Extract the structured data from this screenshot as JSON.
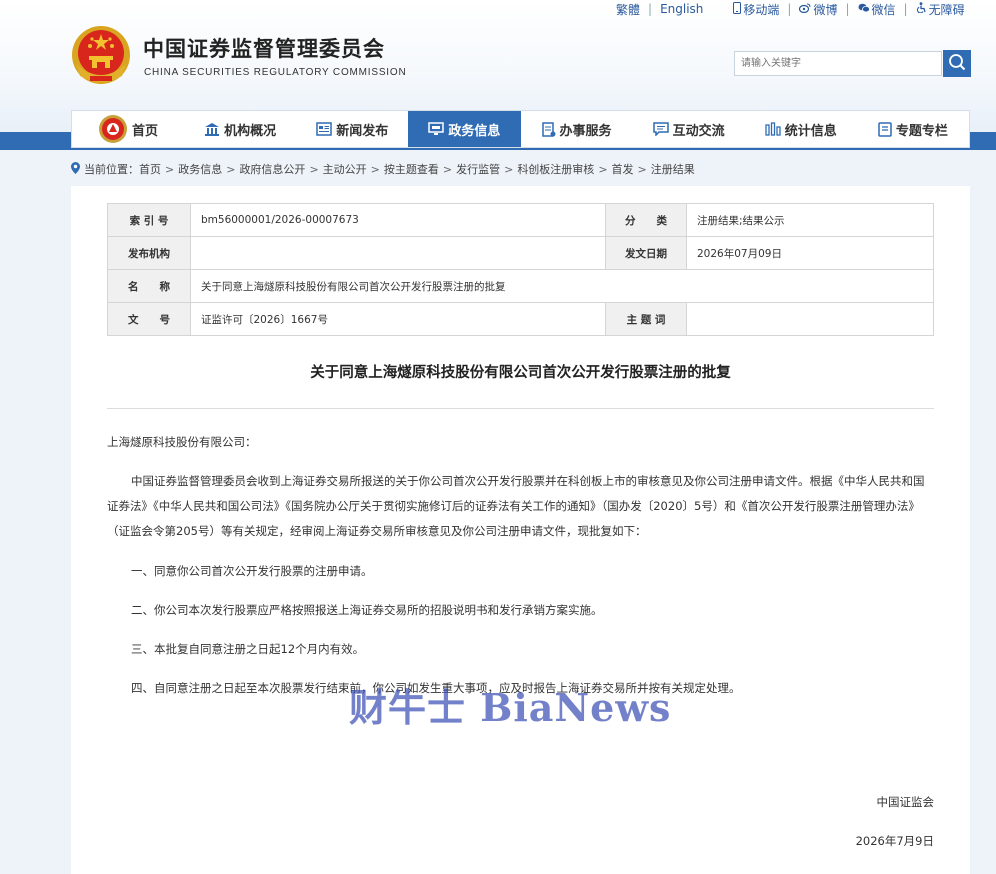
{
  "top_links": {
    "traditional": "繁體",
    "english": "English",
    "mobile": "移动端",
    "weibo": "微博",
    "wechat": "微信",
    "accessibility": "无障碍"
  },
  "site": {
    "title": "中国证券监督管理委员会",
    "subtitle": "CHINA SECURITIES REGULATORY COMMISSION"
  },
  "search": {
    "placeholder": "请输入关键字"
  },
  "nav": [
    {
      "label": "首页",
      "icon": "emblem-icon"
    },
    {
      "label": "机构概况",
      "icon": "building-icon"
    },
    {
      "label": "新闻发布",
      "icon": "news-icon"
    },
    {
      "label": "政务信息",
      "icon": "monitor-icon",
      "active": true
    },
    {
      "label": "办事服务",
      "icon": "document-icon"
    },
    {
      "label": "互动交流",
      "icon": "chat-icon"
    },
    {
      "label": "统计信息",
      "icon": "bar-chart-icon"
    },
    {
      "label": "专题专栏",
      "icon": "book-icon"
    }
  ],
  "breadcrumb": {
    "prefix": "当前位置：",
    "items": [
      "首页",
      "政务信息",
      "政府信息公开",
      "主动公开",
      "按主题查看",
      "发行监管",
      "科创板注册审核",
      "首发",
      "注册结果"
    ]
  },
  "info": {
    "index_label": "索 引 号",
    "index_value": "bm56000001/2026-00007673",
    "category_label": "分　　类",
    "category_value": "注册结果;结果公示",
    "publisher_label": "发布机构",
    "publisher_value": "",
    "date_label": "发文日期",
    "date_value": "2026年07月09日",
    "name_label": "名　　称",
    "name_value": "关于同意上海燧原科技股份有限公司首次公开发行股票注册的批复",
    "docno_label": "文　　号",
    "docno_value": "证监许可〔2026〕1667号",
    "keyword_label": "主 题 词",
    "keyword_value": ""
  },
  "doc": {
    "title": "关于同意上海燧原科技股份有限公司首次公开发行股票注册的批复",
    "salutation": "上海燧原科技股份有限公司：",
    "para1": "中国证券监督管理委员会收到上海证券交易所报送的关于你公司首次公开发行股票并在科创板上市的审核意见及你公司注册申请文件。根据《中华人民共和国证券法》《中华人民共和国公司法》《国务院办公厅关于贯彻实施修订后的证券法有关工作的通知》（国办发〔2020〕5号）和《首次公开发行股票注册管理办法》（证监会令第205号）等有关规定，经审阅上海证券交易所审核意见及你公司注册申请文件，现批复如下：",
    "item1": "一、同意你公司首次公开发行股票的注册申请。",
    "item2": "二、你公司本次发行股票应严格按照报送上海证券交易所的招股说明书和发行承销方案实施。",
    "item3": "三、本批复自同意注册之日起12个月内有效。",
    "item4": "四、自同意注册之日起至本次股票发行结束前，你公司如发生重大事项，应及时报告上海证券交易所并按有关规定处理。",
    "signer": "中国证监会",
    "sign_date": "2026年7月9日"
  },
  "watermark": "财牛士 BiaNews",
  "colors": {
    "brand_blue": "#2f6cb3",
    "emblem_red": "#d9261c",
    "emblem_gold": "#f2c12e"
  }
}
